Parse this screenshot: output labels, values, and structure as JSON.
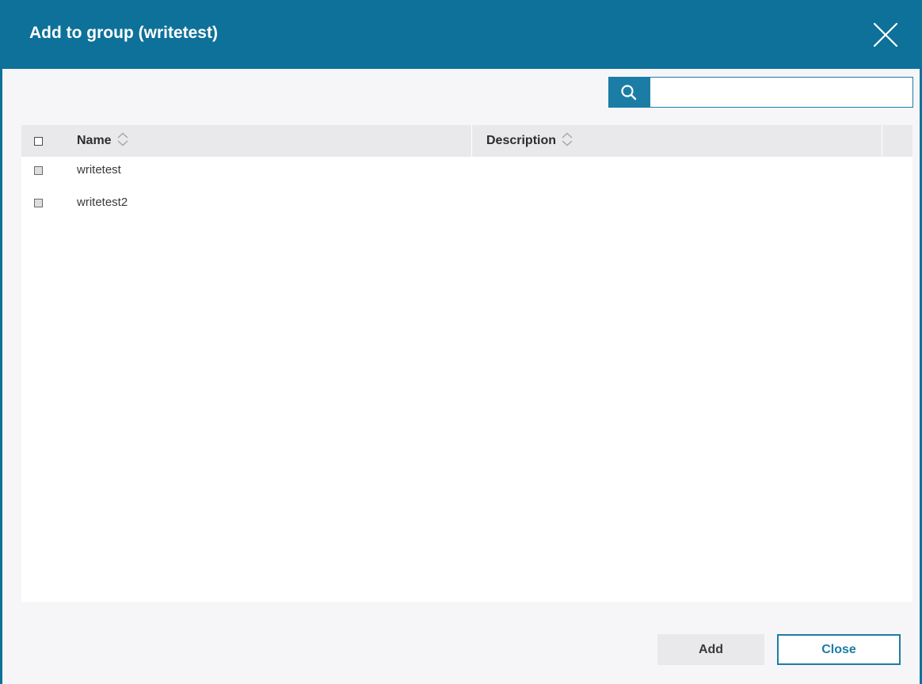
{
  "dialog": {
    "title": "Add to group (writetest)",
    "close_icon": "close-icon"
  },
  "search": {
    "icon": "search-icon",
    "value": "",
    "placeholder": ""
  },
  "table": {
    "columns": [
      {
        "label": "Name",
        "sort_icon": "sort-icon"
      },
      {
        "label": "Description",
        "sort_icon": "sort-icon"
      }
    ],
    "rows": [
      {
        "name": "writetest",
        "description": "",
        "checked": false
      },
      {
        "name": "writetest2",
        "description": "",
        "checked": false
      }
    ]
  },
  "footer": {
    "add_label": "Add",
    "close_label": "Close"
  },
  "colors": {
    "header": "#0e7199",
    "accent": "#1b7da5",
    "panel_bg": "#f6f6f8",
    "table_header_bg": "#e9e9eb"
  }
}
